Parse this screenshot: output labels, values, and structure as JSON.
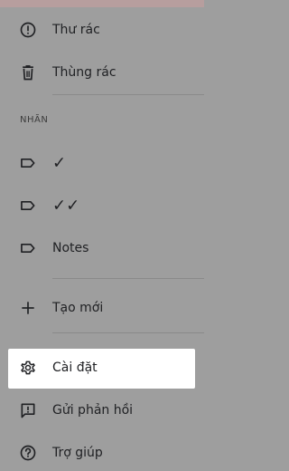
{
  "menu": {
    "spam": {
      "label": "Thư rác",
      "icon": "spam-icon"
    },
    "trash": {
      "label": "Thùng rác",
      "icon": "trash-icon"
    }
  },
  "labels": {
    "section_title": "NHÃN",
    "items": [
      {
        "label": "✓",
        "icon": "label-icon"
      },
      {
        "label": "✓✓",
        "icon": "label-icon"
      },
      {
        "label": "Notes",
        "icon": "label-icon"
      }
    ],
    "create_new": {
      "label": "Tạo mới",
      "icon": "plus-icon"
    }
  },
  "bottom": {
    "settings": {
      "label": "Cài đặt",
      "icon": "gear-icon",
      "selected": true
    },
    "feedback": {
      "label": "Gửi phản hồi",
      "icon": "feedback-icon"
    },
    "help": {
      "label": "Trợ giúp",
      "icon": "help-icon"
    }
  }
}
